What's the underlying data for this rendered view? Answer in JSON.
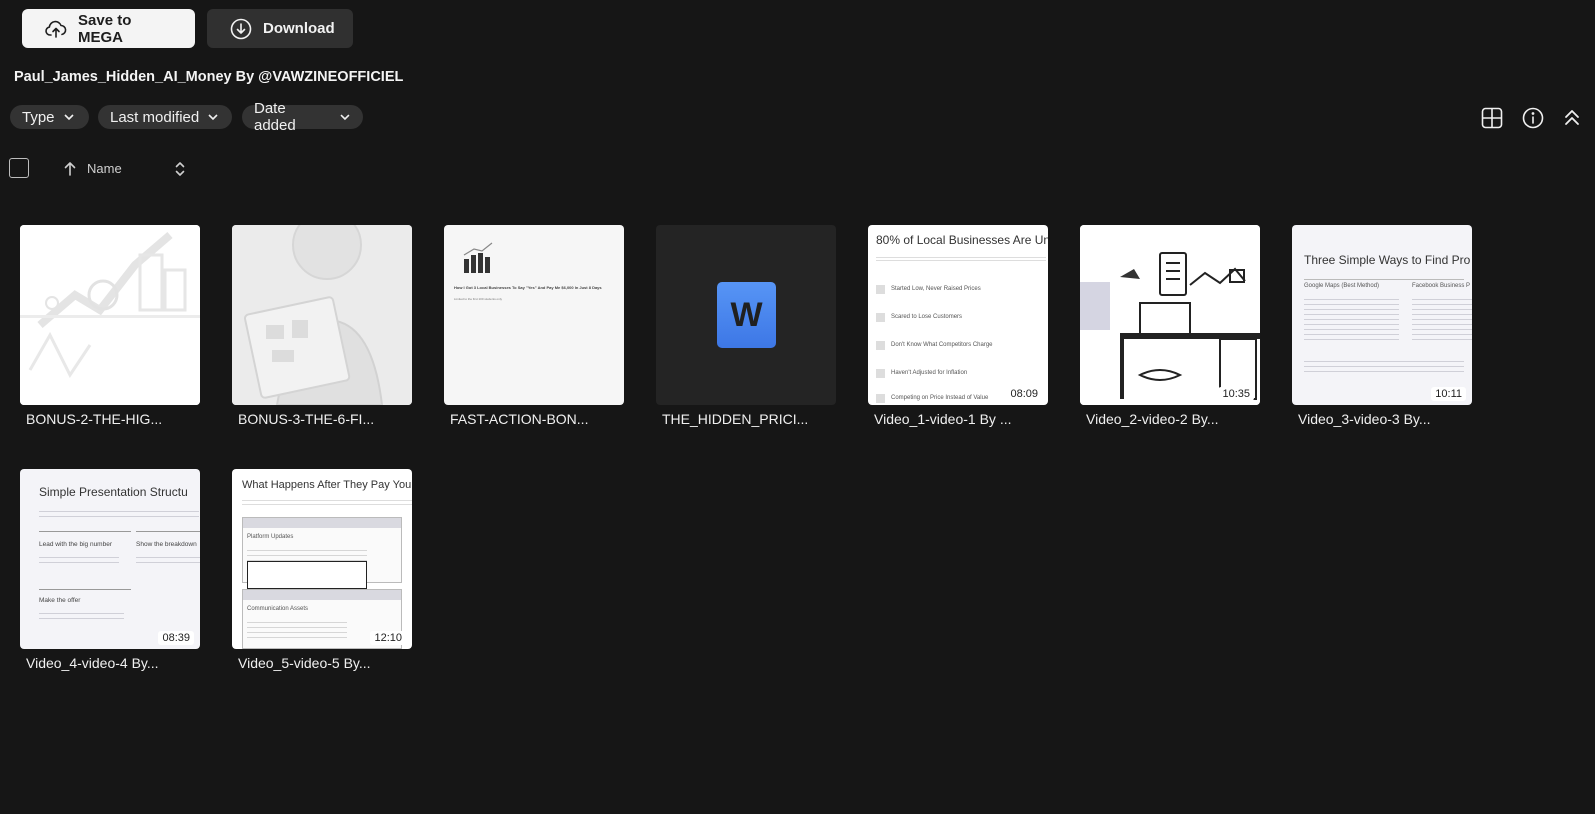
{
  "toolbar": {
    "save_label": "Save to MEGA",
    "download_label": "Download"
  },
  "folder": {
    "title": "Paul_James_Hidden_AI_Money By @VAWZINEOFFICIEL"
  },
  "filters": {
    "type": "Type",
    "last_modified": "Last modified",
    "date_added": "Date added"
  },
  "sort": {
    "label": "Name"
  },
  "icons": {
    "save": "upload-cloud-icon",
    "download": "download-circle-icon",
    "grid": "grid-view-icon",
    "info": "info-icon",
    "collapse": "collapse-icon"
  },
  "files": [
    {
      "name": "BONUS-2-THE-HIG...",
      "duration": ""
    },
    {
      "name": "BONUS-3-THE-6-FI...",
      "duration": ""
    },
    {
      "name": "FAST-ACTION-BON...",
      "duration": "",
      "thumb_heading": "How I Got 3 Local Businesses To Say \"Yes\" And Pay Me $6,000 In Just 8 Days",
      "thumb_sub": "Limited to the first 100 students only"
    },
    {
      "name": "THE_HIDDEN_PRICI...",
      "duration": "",
      "icon_letter": "W"
    },
    {
      "name": "Video_1-video-1 By ...",
      "duration": "08:09",
      "thumb_heading": "80% of Local Businesses Are Un",
      "thumb_items": [
        "Started Low, Never Raised Prices",
        "Scared to Lose Customers",
        "Don't Know What Competitors Charge",
        "Haven't Adjusted for Inflation",
        "Competing on Price Instead of Value"
      ]
    },
    {
      "name": "Video_2-video-2 By...",
      "duration": "10:35"
    },
    {
      "name": "Video_3-video-3 By...",
      "duration": "10:11",
      "thumb_heading": "Three Simple Ways to Find Pro",
      "thumb_items": [
        "Google Maps (Best Method)",
        "Facebook Business P"
      ]
    },
    {
      "name": "Video_4-video-4 By...",
      "duration": "08:39",
      "thumb_heading": "Simple Presentation Structu",
      "thumb_items": [
        "Lead with the big number",
        "Show the breakdown",
        "Make the offer"
      ]
    },
    {
      "name": "Video_5-video-5 By...",
      "duration": "12:10",
      "thumb_heading": "What Happens After They Pay You",
      "thumb_items": [
        "Platform Updates",
        "Communication Assets"
      ]
    }
  ],
  "colors": {
    "background": "#161616",
    "button_light": "#f4f4f4",
    "button_dark": "#303030",
    "word_blue": "#3f7ff0"
  }
}
